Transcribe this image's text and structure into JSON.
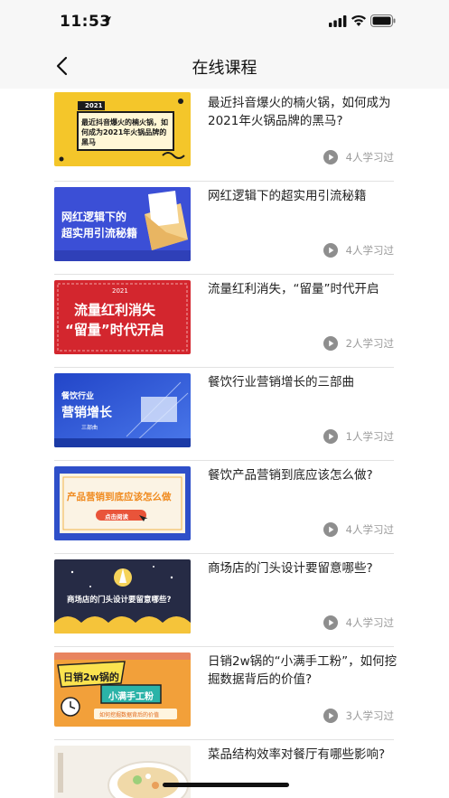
{
  "status_bar": {
    "time": "11:53"
  },
  "nav": {
    "title": "在线课程"
  },
  "courses": [
    {
      "title": "最近抖音爆火的楠火锅，如何成为2021年火锅品牌的黑马?",
      "learners": "4人学习过",
      "thumb": {
        "badge": "2021",
        "text": "最近抖音爆火的楠火锅，如何成为2021年火锅品牌的黑马",
        "bg": "#f4c62a"
      }
    },
    {
      "title": "网红逻辑下的超实用引流秘籍",
      "learners": "4人学习过",
      "thumb": {
        "line1": "网红逻辑下的",
        "line2": "超实用引流秘籍",
        "bg": "#3b4fd6"
      }
    },
    {
      "title": "流量红利消失，“留量”时代开启",
      "learners": "2人学习过",
      "thumb": {
        "badge": "2021",
        "line1": "流量红利消失",
        "line2": "“留量”时代开启",
        "bg": "#d3262e"
      }
    },
    {
      "title": "餐饮行业营销增长的三部曲",
      "learners": "1人学习过",
      "thumb": {
        "line1": "餐饮行业",
        "line2": "营销增长",
        "line3": "三部曲",
        "bg": "#2f55d4"
      }
    },
    {
      "title": "餐饮产品营销到底应该怎么做?",
      "learners": "4人学习过",
      "thumb": {
        "line1": "产品营销到底应该怎么做",
        "button": "点击阅读",
        "bg": "#2e4fc9"
      }
    },
    {
      "title": "商场店的门头设计要留意哪些?",
      "learners": "4人学习过",
      "thumb": {
        "line1": "商场店的门头设计要留意哪些?",
        "bg": "#262b45"
      }
    },
    {
      "title": "日销2w锅的“小满手工粉”，如何挖掘数据背后的价值?",
      "learners": "3人学习过",
      "thumb": {
        "line1": "日销2w锅的",
        "line2": "小满手工粉",
        "line3": "如何挖掘数据背后的价值",
        "bg": "#f2a03a"
      }
    },
    {
      "title": "菜品结构效率对餐厅有哪些影响?",
      "learners": "",
      "thumb": {
        "bg": "#f3efe8"
      }
    }
  ],
  "colors": {
    "accent_blue": "#3b4fd6",
    "divider": "#e2e2e2",
    "meta_gray": "#9a9a9a"
  }
}
